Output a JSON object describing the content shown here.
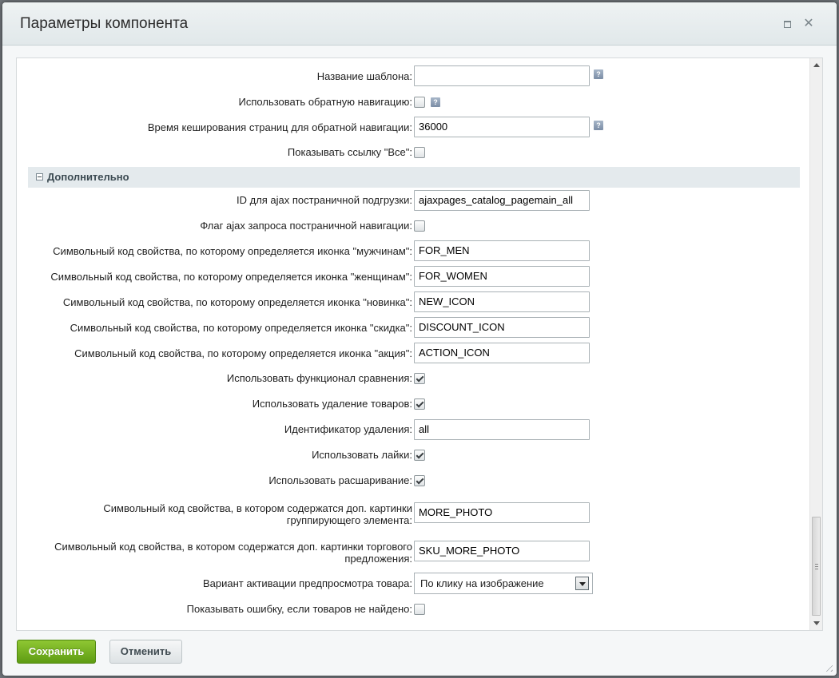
{
  "dialog": {
    "title": "Параметры компонента",
    "maximize_icon": "maximize-icon",
    "close_icon": "close-icon"
  },
  "fields": {
    "template_name": {
      "label": "Название шаблона:",
      "value": ""
    },
    "reverse_nav": {
      "label": "Использовать обратную навигацию:",
      "checked": false
    },
    "cache_time": {
      "label": "Время кеширования страниц для обратной навигации:",
      "value": "36000"
    },
    "show_all_link": {
      "label": "Показывать ссылку \"Все\":",
      "checked": false
    }
  },
  "section": {
    "title": "Дополнительно",
    "toggle_icon": "collapse-icon"
  },
  "advanced": {
    "ajax_id": {
      "label": "ID для ajax постраничной подгрузки:",
      "value": "ajaxpages_catalog_pagemain_all"
    },
    "ajax_flag": {
      "label": "Флаг ajax запроса постраничной навигации:",
      "checked": false
    },
    "icon_men": {
      "label": "Символьный код свойства, по которому определяется иконка \"мужчинам\":",
      "value": "FOR_MEN"
    },
    "icon_women": {
      "label": "Символьный код свойства, по которому определяется иконка \"женщинам\":",
      "value": "FOR_WOMEN"
    },
    "icon_new": {
      "label": "Символьный код свойства, по которому определяется иконка \"новинка\":",
      "value": "NEW_ICON"
    },
    "icon_discount": {
      "label": "Символьный код свойства, по которому определяется иконка \"скидка\":",
      "value": "DISCOUNT_ICON"
    },
    "icon_action": {
      "label": "Символьный код свойства, по которому определяется иконка \"акция\":",
      "value": "ACTION_ICON"
    },
    "use_compare": {
      "label": "Использовать функционал сравнения:",
      "checked": true
    },
    "use_delete": {
      "label": "Использовать удаление товаров:",
      "checked": true
    },
    "delete_id": {
      "label": "Идентификатор удаления:",
      "value": "all"
    },
    "use_likes": {
      "label": "Использовать лайки:",
      "checked": true
    },
    "use_share": {
      "label": "Использовать расшаривание:",
      "checked": true
    },
    "more_photo": {
      "label": "Символьный код свойства, в котором содержатся доп. картинки группирующего элемента:",
      "value": "MORE_PHOTO"
    },
    "sku_more_photo": {
      "label": "Символьный код свойства, в котором содержатся доп. картинки торгового предложения:",
      "value": "SKU_MORE_PHOTO"
    },
    "preview_mode": {
      "label": "Вариант активации предпросмотра товара:",
      "value": "По клику на изображение"
    },
    "show_error": {
      "label": "Показывать ошибку, если товаров не найдено:",
      "checked": false
    }
  },
  "help_icon": "?",
  "footer": {
    "save_label": "Сохранить",
    "cancel_label": "Отменить"
  },
  "colors": {
    "save_button": "#6aa91d",
    "section_bg": "#e4eaed"
  }
}
